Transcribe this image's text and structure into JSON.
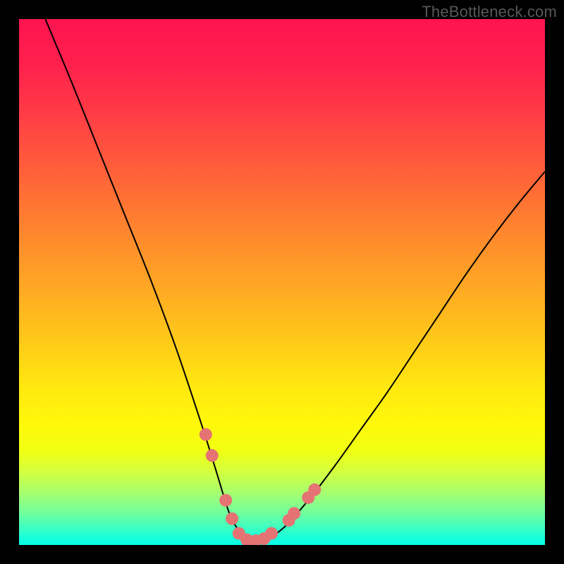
{
  "watermark": "TheBottleneck.com",
  "chart_data": {
    "type": "line",
    "title": "",
    "xlabel": "",
    "ylabel": "",
    "xlim": [
      0,
      100
    ],
    "ylim": [
      0,
      100
    ],
    "background_gradient": {
      "direction": "vertical",
      "stops": [
        {
          "pos": 0,
          "color": "#ff1450"
        },
        {
          "pos": 50,
          "color": "#ffbf1c"
        },
        {
          "pos": 78,
          "color": "#fff80a"
        },
        {
          "pos": 100,
          "color": "#06ffe8"
        }
      ]
    },
    "series": [
      {
        "name": "bottleneck-curve",
        "color": "#000000",
        "width": 2,
        "x": [
          5,
          10,
          15,
          20,
          25,
          30,
          35,
          37.5,
          40,
          42,
          44,
          46,
          50,
          55,
          60,
          65,
          70,
          75,
          80,
          85,
          90,
          95,
          100
        ],
        "values": [
          100,
          88,
          75.5,
          63,
          50.5,
          37,
          22,
          14,
          6,
          2.5,
          0.8,
          0.8,
          3,
          8.5,
          15,
          22,
          29,
          36.5,
          44,
          51.5,
          58.5,
          65,
          71
        ]
      }
    ],
    "markers": {
      "name": "highlight-points",
      "color": "#e57373",
      "radius": 9,
      "points": [
        {
          "x": 35.5,
          "y": 21
        },
        {
          "x": 36.7,
          "y": 17
        },
        {
          "x": 39.3,
          "y": 8.5
        },
        {
          "x": 40.5,
          "y": 5
        },
        {
          "x": 41.8,
          "y": 2.2
        },
        {
          "x": 43.3,
          "y": 1
        },
        {
          "x": 45,
          "y": 0.8
        },
        {
          "x": 46.6,
          "y": 1.2
        },
        {
          "x": 48,
          "y": 2.2
        },
        {
          "x": 51.3,
          "y": 4.7
        },
        {
          "x": 52.3,
          "y": 6
        },
        {
          "x": 55,
          "y": 9
        },
        {
          "x": 56.2,
          "y": 10.5
        }
      ]
    }
  }
}
